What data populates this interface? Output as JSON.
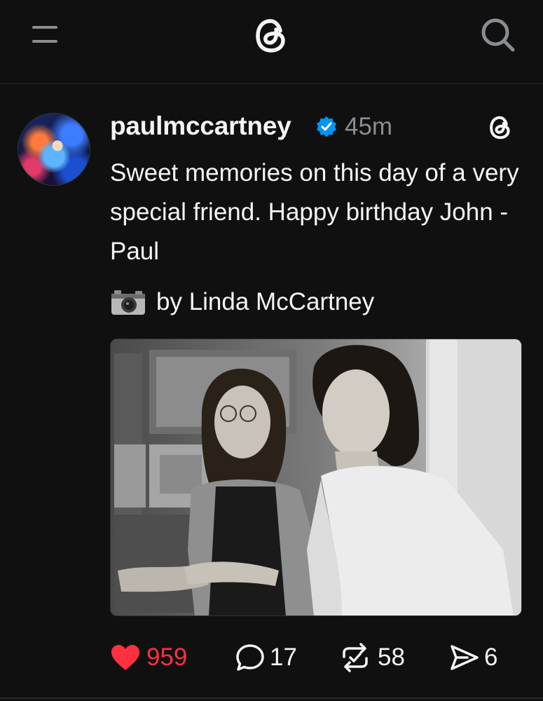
{
  "topbar": {
    "menu_icon": "hamburger-menu-icon",
    "logo_icon": "threads-logo-icon",
    "search_icon": "search-icon"
  },
  "post": {
    "username": "paulmccartney",
    "verified": true,
    "timestamp": "45m",
    "text": "Sweet memories on this day of a very special friend. Happy birthday John - Paul",
    "caption": "by Linda McCartney",
    "caption_icon": "camera-icon",
    "image_description_icon": "photo",
    "actions": {
      "likes": "959",
      "comments": "17",
      "reposts": "58",
      "shares": "6"
    }
  },
  "colors": {
    "background": "#101010",
    "text": "#f3f5f7",
    "muted": "#8a8d91",
    "like": "#ff3040",
    "verified": "#0095f6"
  }
}
